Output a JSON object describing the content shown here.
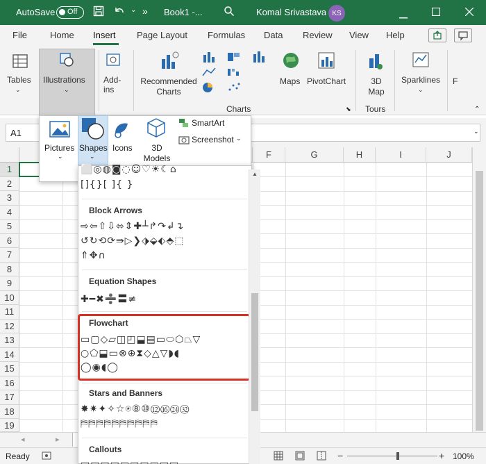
{
  "titlebar": {
    "autosave": "AutoSave",
    "toggle": "Off",
    "doc": "Book1 -...",
    "user": "Komal Srivastava",
    "initials": "KS"
  },
  "menu": [
    "File",
    "Home",
    "Insert",
    "Page Layout",
    "Formulas",
    "Data",
    "Review",
    "View",
    "Help"
  ],
  "ribbon": {
    "tables": "Tables",
    "illustrations": "Illustrations",
    "addins": "Add-ins",
    "recommended": "Recommended Charts",
    "maps": "Maps",
    "pivotchart": "PivotChart",
    "map3d": "3D Map",
    "sparklines": "Sparklines",
    "filters": "F",
    "group_charts": "Charts",
    "group_tours": "Tours"
  },
  "formula": {
    "namebox": "A1"
  },
  "columns": [
    "F",
    "G",
    "H",
    "I",
    "J"
  ],
  "rows": [
    "1",
    "2",
    "3",
    "4",
    "5",
    "6",
    "7",
    "8",
    "9",
    "10",
    "11",
    "12",
    "13",
    "14",
    "15",
    "16",
    "17",
    "18",
    "19"
  ],
  "illus_panel": {
    "pictures": "Pictures",
    "shapes": "Shapes",
    "icons": "Icons",
    "models": "3D Models",
    "smartart": "SmartArt",
    "screenshot": "Screenshot"
  },
  "gallery": {
    "block_arrows": "Block Arrows",
    "equation": "Equation Shapes",
    "flowchart": "Flowchart",
    "stars": "Stars and Banners",
    "callouts": "Callouts",
    "row_top1": "⬜◎◍◙◌☺♡☀☾⌂",
    "row_top2": "[]{}[ ]{ }",
    "ba1": "⇨⇦⇧⇩⬄⇕✚┴↱↷↲↴",
    "ba2": "↺↻⟲⟳⇛▷❯⬗⬙⬖⬘⬚",
    "ba3": "⇑✥∩",
    "eq1": "✚━✖➗〓≠",
    "fc1": "▭▢◇▱◫◰⬓▤▭⬭⬡⏢▽",
    "fc2": "○⬠⬓▭⊗⊕⧗◇△▽◗◖",
    "fc3": "◯◉◖◯",
    "st1": "✸✷✦✧☆⍟⑧⑩⑫⑯㉔㉜",
    "st2": "⛿⛿⛿⛿⛿⛿⛿⛿⛿⛿",
    "co1": "▭▭▭▭▭▭▭▭▭▭"
  },
  "status": {
    "ready": "Ready",
    "zoom": "100%"
  }
}
